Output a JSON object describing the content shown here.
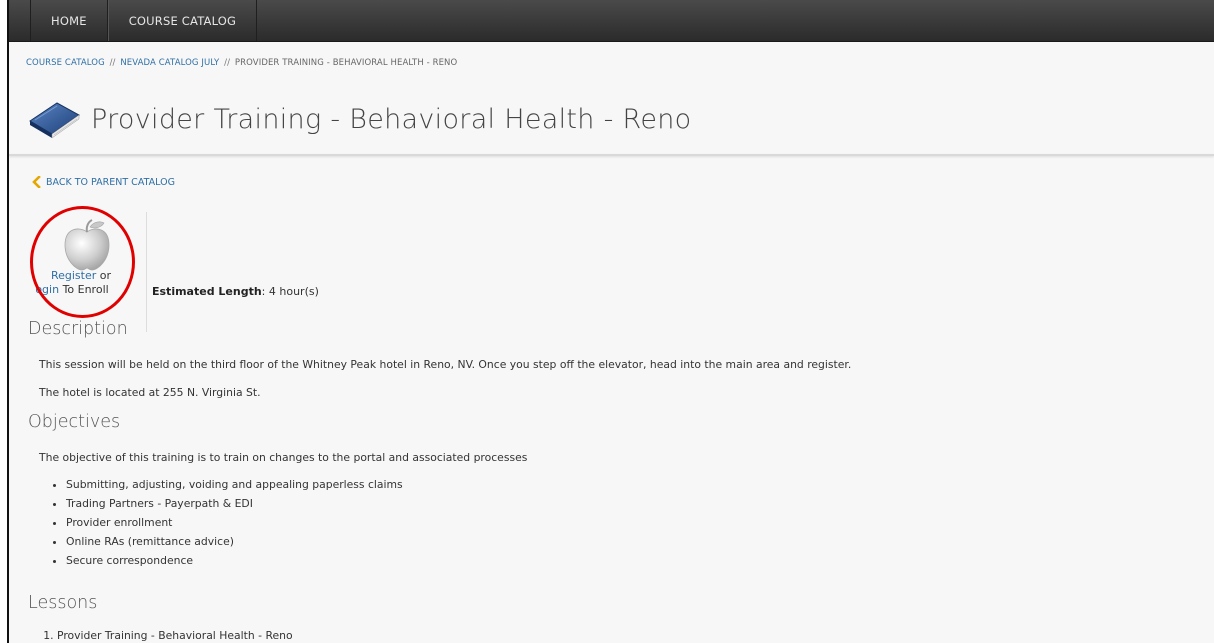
{
  "nav": {
    "items": [
      {
        "label": "HOME"
      },
      {
        "label": "COURSE CATALOG"
      }
    ]
  },
  "breadcrumb": {
    "items": [
      "COURSE CATALOG",
      "NEVADA CATALOG JULY",
      "PROVIDER TRAINING - BEHAVIORAL HEALTH - RENO"
    ],
    "separator": "//"
  },
  "page": {
    "title": "Provider Training - Behavioral Health - Reno",
    "back_label": "BACK TO PARENT CATALOG"
  },
  "enroll": {
    "register_label": "Register",
    "or_text": "or",
    "login_label": "ogin",
    "to_enroll_text": "To Enroll"
  },
  "estimated": {
    "label": "Estimated Length",
    "value": ": 4 hour(s)"
  },
  "description": {
    "heading": "Description",
    "paragraphs": [
      "This session will be held on the third floor of the Whitney Peak hotel in Reno, NV. Once you step off the elevator, head into the main area and register.",
      "The hotel is located at 255 N. Virginia St."
    ]
  },
  "objectives": {
    "heading": "Objectives",
    "intro": "The objective of this training is to train on changes to the portal and associated processes",
    "items": [
      "Submitting, adjusting, voiding and appealing paperless claims",
      "Trading Partners - Payerpath & EDI",
      "Provider enrollment",
      "Online RAs (remittance advice)",
      "Secure correspondence"
    ]
  },
  "lessons": {
    "heading": "Lessons",
    "items": [
      "Provider Training - Behavioral Health - Reno"
    ]
  },
  "icons": {
    "title_icon": "book-icon",
    "back_icon": "chevron-left-icon",
    "enroll_icon": "apple-icon"
  },
  "colors": {
    "link": "#2f6fa6",
    "chevron": "#e3a700",
    "highlight_circle": "#e00000",
    "topbar": "#3a3a3a"
  }
}
